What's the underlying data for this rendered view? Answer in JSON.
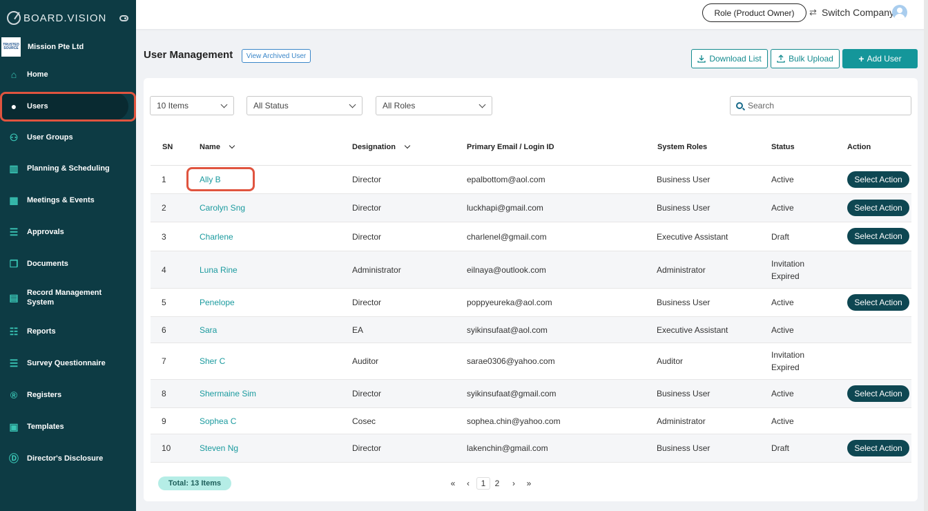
{
  "sidebar": {
    "brand": "BOARD.VISION",
    "company_logo_text": "TRUSTED SOURCE",
    "company_name": "Mission Pte Ltd",
    "items": [
      {
        "label": "Home",
        "icon": "home-icon"
      },
      {
        "label": "Users",
        "icon": "user-icon"
      },
      {
        "label": "User Groups",
        "icon": "user-group-icon"
      },
      {
        "label": "Planning & Scheduling",
        "icon": "bar-chart-icon"
      },
      {
        "label": "Meetings & Events",
        "icon": "calendar-icon"
      },
      {
        "label": "Approvals",
        "icon": "checklist-icon"
      },
      {
        "label": "Documents",
        "icon": "documents-icon"
      },
      {
        "label": "Record Management System",
        "icon": "record-icon"
      },
      {
        "label": "Reports",
        "icon": "report-icon"
      },
      {
        "label": "Survey Questionnaire",
        "icon": "survey-icon"
      },
      {
        "label": "Registers",
        "icon": "registered-icon"
      },
      {
        "label": "Templates",
        "icon": "template-icon"
      },
      {
        "label": "Director's Disclosure",
        "icon": "disclosure-icon"
      }
    ],
    "active_item": "Users"
  },
  "topbar": {
    "role_label": "Role (Product Owner)",
    "switch_company_label": "Switch Company"
  },
  "header": {
    "title": "User Management",
    "archived_label": "View Archived User",
    "download_label": "Download List",
    "bulk_upload_label": "Bulk Upload",
    "add_user_label": "Add User"
  },
  "filters": {
    "items_select": "10 Items",
    "status_select": "All Status",
    "roles_select": "All Roles",
    "search_placeholder": "Search"
  },
  "table": {
    "columns": [
      "SN",
      "Name",
      "Designation",
      "Primary Email / Login ID",
      "System Roles",
      "Status",
      "Action"
    ],
    "action_label": "Select Action",
    "rows": [
      {
        "sn": "1",
        "name": "Ally B",
        "designation": "Director",
        "email": "epalbottom@aol.com",
        "role": "Business User",
        "status": "Active",
        "status2": "",
        "action": true
      },
      {
        "sn": "2",
        "name": "Carolyn Sng",
        "designation": "Director",
        "email": "luckhapi@gmail.com",
        "role": "Business User",
        "status": "Active",
        "status2": "",
        "action": true
      },
      {
        "sn": "3",
        "name": "Charlene",
        "designation": "Director",
        "email": "charlenel@gmail.com",
        "role": "Executive Assistant",
        "status": "Draft",
        "status2": "",
        "action": true
      },
      {
        "sn": "4",
        "name": "Luna Rine",
        "designation": "Administrator",
        "email": "eilnaya@outlook.com",
        "role": "Administrator",
        "status": "Invitation",
        "status2": "Expired",
        "action": false
      },
      {
        "sn": "5",
        "name": "Penelope",
        "designation": "Director",
        "email": "poppyeureka@aol.com",
        "role": "Business User",
        "status": "Active",
        "status2": "",
        "action": true
      },
      {
        "sn": "6",
        "name": "Sara",
        "designation": "EA",
        "email": "syikinsufaat@aol.com",
        "role": "Executive Assistant",
        "status": "Active",
        "status2": "",
        "action": false
      },
      {
        "sn": "7",
        "name": "Sher C",
        "designation": "Auditor",
        "email": "sarae0306@yahoo.com",
        "role": "Auditor",
        "status": "Invitation",
        "status2": "Expired",
        "action": false
      },
      {
        "sn": "8",
        "name": "Shermaine Sim",
        "designation": "Director",
        "email": "syikinsufaat@gmail.com",
        "role": "Business User",
        "status": "Active",
        "status2": "",
        "action": true
      },
      {
        "sn": "9",
        "name": "Sophea C",
        "designation": "Cosec",
        "email": "sophea.chin@yahoo.com",
        "role": "Administrator",
        "status": "Active",
        "status2": "",
        "action": false
      },
      {
        "sn": "10",
        "name": "Steven Ng",
        "designation": "Director",
        "email": "lakenchin@gmail.com",
        "role": "Business User",
        "status": "Draft",
        "status2": "",
        "action": true
      }
    ]
  },
  "footer": {
    "total_label": "Total: 13 Items",
    "pages": [
      "1",
      "2"
    ],
    "current_page": "1"
  }
}
